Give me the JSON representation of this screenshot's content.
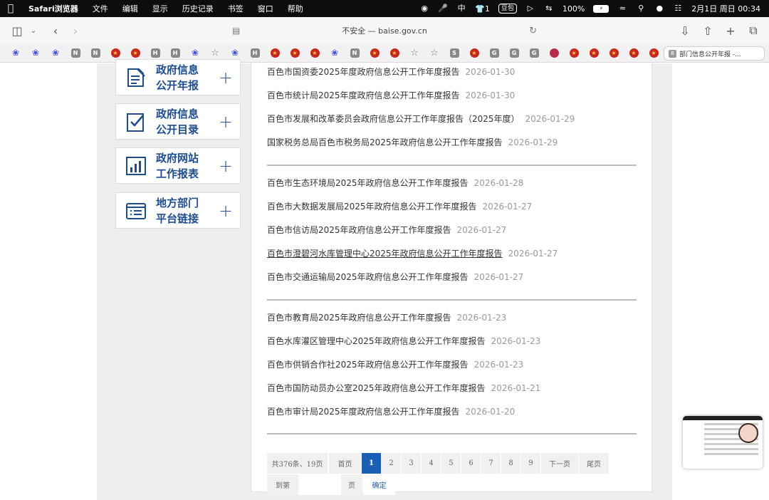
{
  "menubar": {
    "app_name": "Safari浏览器",
    "menus": [
      "文件",
      "编辑",
      "显示",
      "历史记录",
      "书签",
      "窗口",
      "帮助"
    ],
    "status_badge": "豆包",
    "tray_count": "1",
    "battery_percent": "100%",
    "datetime": "2月1日 周日  00:34"
  },
  "toolbar": {
    "address": "不安全 — baise.gov.cn"
  },
  "favorites": [
    "paw",
    "paw",
    "paw",
    "N",
    "N",
    "emblem",
    "emblem",
    "H",
    "H",
    "paw",
    "star",
    "paw",
    "H",
    "emblem",
    "emblem",
    "emblem",
    "paw",
    "N",
    "emblem",
    "emblem",
    "star",
    "star",
    "S",
    "emblem",
    "G",
    "G",
    "G",
    "red",
    "emblem",
    "emblem",
    "emblem",
    "emblem",
    "emblem"
  ],
  "active_tab": {
    "icon_letter": "B",
    "title": "部门信息公开年报 -..."
  },
  "sidebar": {
    "cards": [
      {
        "line1": "政府信息",
        "line2": "公开年报",
        "icon": "document-pencil-icon"
      },
      {
        "line1": "政府信息",
        "line2": "公开目录",
        "icon": "checklist-icon"
      },
      {
        "line1": "政府网站",
        "line2": "工作报表",
        "icon": "bar-chart-icon"
      },
      {
        "line1": "地方部门",
        "line2": "平台链接",
        "icon": "list-card-icon"
      }
    ],
    "plus": "+"
  },
  "reports": [
    {
      "title": "百色市国资委2025年度政府信息公开工作年度报告",
      "date": "2026-01-30"
    },
    {
      "title": "百色市统计局2025年度政府信息公开工作年度报告",
      "date": "2026-01-30"
    },
    {
      "title": "百色市发展和改革委员会政府信息公开工作年度报告（2025年度）",
      "date": "2026-01-29"
    },
    {
      "title": "国家税务总局百色市税务局2025年政府信息公开工作年度报告",
      "date": "2026-01-29"
    },
    {
      "title": "百色市生态环境局2025年政府信息公开工作年度报告",
      "date": "2026-01-28"
    },
    {
      "title": "百色市大数据发展局2025年政府信息公开工作年度报告",
      "date": "2026-01-27"
    },
    {
      "title": "百色市信访局2025年政府信息公开工作年度报告",
      "date": "2026-01-27"
    },
    {
      "title": "百色市澄碧河水库管理中心2025年政府信息公开工作年度报告",
      "date": "2026-01-27"
    },
    {
      "title": "百色市交通运输局2025年政府信息公开工作年度报告",
      "date": "2026-01-27"
    },
    {
      "title": "百色市教育局2025年政府信息公开工作年度报告",
      "date": "2026-01-23"
    },
    {
      "title": "百色水库灌区管理中心2025年政府信息公开工作年度报告",
      "date": "2026-01-23"
    },
    {
      "title": "百色市供销合作社2025年政府信息公开工作年度报告",
      "date": "2026-01-23"
    },
    {
      "title": "百色市国防动员办公室2025年政府信息公开工作年度报告",
      "date": "2026-01-21"
    },
    {
      "title": "百色市审计局2025年度政府信息公开工作年度报告",
      "date": "2026-01-20"
    }
  ],
  "pagination": {
    "summary": "共376条、19页",
    "first": "首页",
    "pages": [
      "1",
      "2",
      "3",
      "4",
      "5",
      "6",
      "7",
      "8",
      "9"
    ],
    "current": "1",
    "next": "下一页",
    "last": "尾页",
    "goto_prefix": "到第",
    "goto_suffix": "页",
    "confirm": "确定"
  },
  "colors": {
    "accent": "#1a5fb4",
    "sidebar_text": "#1f4d8c"
  }
}
